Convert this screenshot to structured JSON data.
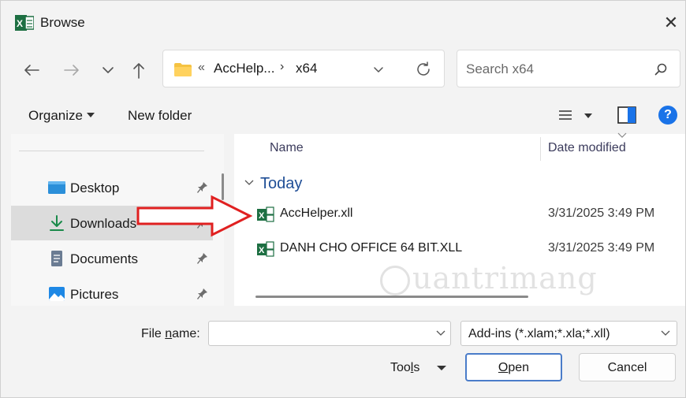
{
  "window": {
    "title": "Browse",
    "close_glyph": "✕"
  },
  "address": {
    "overflow": "«",
    "crumbs": [
      "AccHelp...",
      "x64"
    ],
    "separator": "›"
  },
  "search": {
    "placeholder": "Search x64"
  },
  "toolbar": {
    "organize_label": "Organize",
    "new_folder_label": "New folder",
    "help_glyph": "?"
  },
  "nav": {
    "items": [
      {
        "label": "Desktop",
        "icon": "desktop-icon"
      },
      {
        "label": "Downloads",
        "icon": "download-icon",
        "selected": true
      },
      {
        "label": "Documents",
        "icon": "documents-icon"
      },
      {
        "label": "Pictures",
        "icon": "pictures-icon"
      }
    ]
  },
  "files": {
    "columns": {
      "name": "Name",
      "date": "Date modified"
    },
    "group": "Today",
    "rows": [
      {
        "name": "AccHelper.xll",
        "date": "3/31/2025 3:49 PM"
      },
      {
        "name": "DANH CHO OFFICE 64 BIT.XLL",
        "date": "3/31/2025 3:49 PM"
      }
    ]
  },
  "watermark": "uantrimang",
  "footer": {
    "file_name_label_pre": "File ",
    "file_name_label_u": "n",
    "file_name_label_post": "ame:",
    "file_name_value": "",
    "filter": "Add-ins (*.xlam;*.xla;*.xll)",
    "tools_pre": "Too",
    "tools_u": "l",
    "tools_post": "s",
    "open_u": "O",
    "open_post": "pen",
    "cancel_label": "Cancel"
  },
  "colors": {
    "accent": "#1a73e8",
    "excel_green": "#1d6f42",
    "arrow_red": "#e02020"
  }
}
